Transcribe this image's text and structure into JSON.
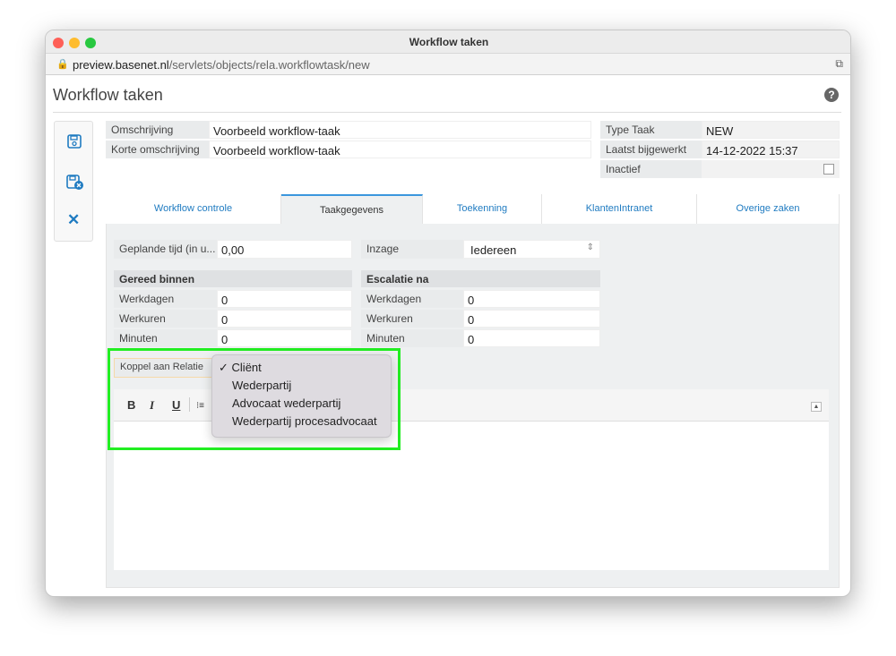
{
  "window": {
    "title": "Workflow taken",
    "url_host": "preview.basenet.nl",
    "url_path": "/servlets/objects/rela.workflowtask/new"
  },
  "page": {
    "title": "Workflow taken",
    "help_icon": "?"
  },
  "toolbar": {
    "icons": [
      "save-icon",
      "save-close-icon",
      "close-icon"
    ],
    "close_glyph": "✕"
  },
  "fields": {
    "omschrijving_label": "Omschrijving",
    "omschrijving_value": "Voorbeeld workflow-taak",
    "korte_label": "Korte omschrijving",
    "korte_value": "Voorbeeld workflow-taak",
    "type_label": "Type Taak",
    "type_value": "NEW",
    "bijgewerkt_label": "Laatst bijgewerkt",
    "bijgewerkt_value": "14-12-2022 15:37",
    "inactief_label": "Inactief"
  },
  "tabs": [
    {
      "label": "Workflow controle"
    },
    {
      "label": "Taakgegevens",
      "active": true
    },
    {
      "label": "Toekenning"
    },
    {
      "label": "KlantenIntranet"
    },
    {
      "label": "Overige zaken"
    }
  ],
  "taak": {
    "gepland_label": "Geplande tijd (in u...",
    "gepland_value": "0,00",
    "inzage_label": "Inzage",
    "inzage_value": "Iedereen",
    "gereed": {
      "title": "Gereed binnen",
      "rows": [
        {
          "label": "Werkdagen",
          "value": "0"
        },
        {
          "label": "Werkuren",
          "value": "0"
        },
        {
          "label": "Minuten",
          "value": "0"
        }
      ]
    },
    "escalatie": {
      "title": "Escalatie na",
      "rows": [
        {
          "label": "Werkdagen",
          "value": "0"
        },
        {
          "label": "Werkuren",
          "value": "0"
        },
        {
          "label": "Minuten",
          "value": "0"
        }
      ]
    },
    "koppel_label": "Koppel aan Relatie"
  },
  "editor": {
    "bold": "B",
    "italic": "I",
    "underline": "U",
    "list": "⁝≡"
  },
  "dropdown": {
    "options": [
      "Cliënt",
      "Wederpartij",
      "Advocaat wederpartij",
      "Wederpartij procesadvocaat"
    ],
    "selected": "Cliënt",
    "check": "✓"
  },
  "highlight_color": "#22ee22"
}
